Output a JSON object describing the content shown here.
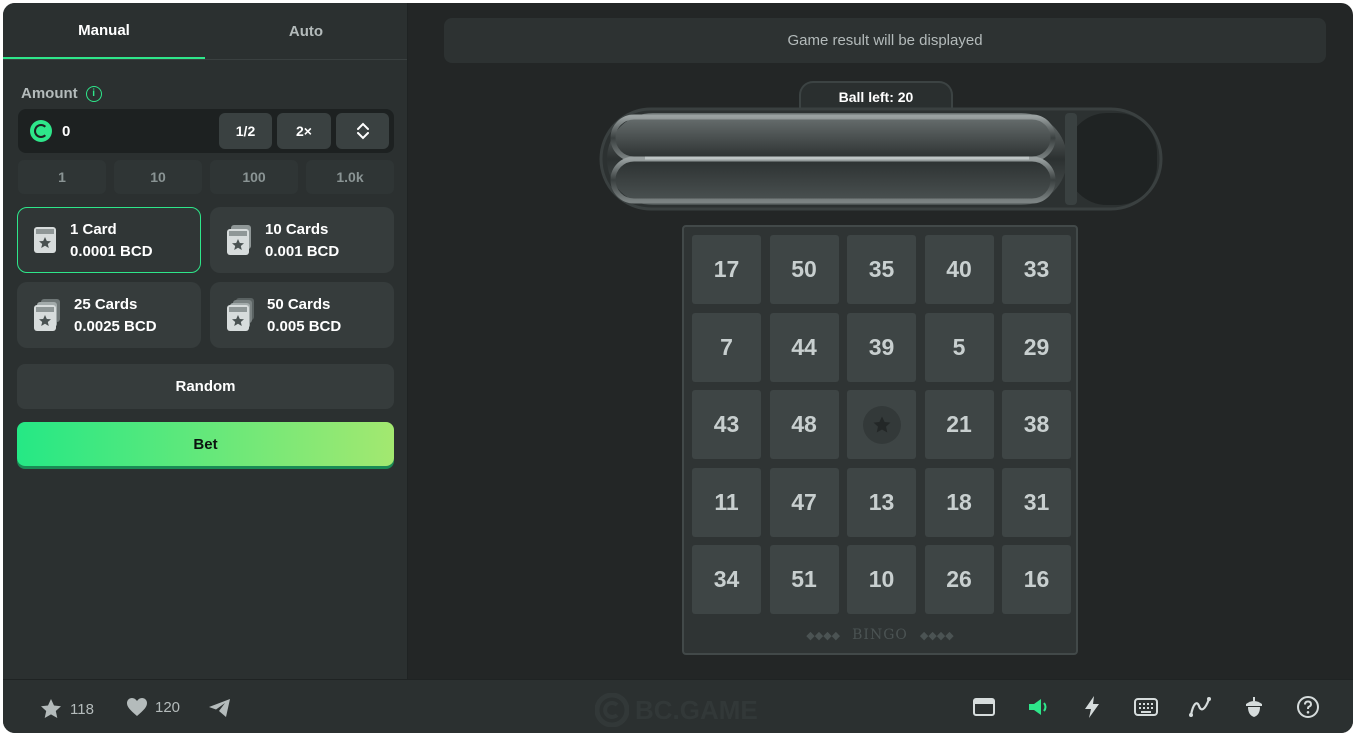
{
  "tabs": [
    {
      "label": "Manual",
      "active": true
    },
    {
      "label": "Auto",
      "active": false
    }
  ],
  "amount": {
    "label": "Amount",
    "info_icon": "info-icon",
    "value": "0",
    "currency_icon": "bc-coin-icon",
    "half_label": "1/2",
    "double_label": "2×"
  },
  "quick_amounts": [
    "1",
    "10",
    "100",
    "1.0k"
  ],
  "card_options": [
    {
      "title": "1 Card",
      "price": "0.0001 BCD",
      "selected": true
    },
    {
      "title": "10 Cards",
      "price": "0.001 BCD",
      "selected": false
    },
    {
      "title": "25 Cards",
      "price": "0.0025 BCD",
      "selected": false
    },
    {
      "title": "50 Cards",
      "price": "0.005 BCD",
      "selected": false
    }
  ],
  "random_label": "Random",
  "bet_label": "Bet",
  "result_text": "Game result will be displayed",
  "ball_left": "Ball left: 20",
  "board": {
    "numbers": [
      [
        "17",
        "50",
        "35",
        "40",
        "33"
      ],
      [
        "7",
        "44",
        "39",
        "5",
        "29"
      ],
      [
        "43",
        "48",
        "",
        "21",
        "38"
      ],
      [
        "11",
        "47",
        "13",
        "18",
        "31"
      ],
      [
        "34",
        "51",
        "10",
        "26",
        "16"
      ]
    ],
    "free_icon": "star-icon",
    "footer_label": "BINGO"
  },
  "footer": {
    "favorites_count": "118",
    "likes_count": "120",
    "brand": "BC.GAME"
  },
  "colors": {
    "accent": "#2ee68a",
    "background": "#232626",
    "panel": "#2b3030",
    "bet_gradient_start": "#25e885",
    "bet_gradient_end": "#a3e870"
  }
}
